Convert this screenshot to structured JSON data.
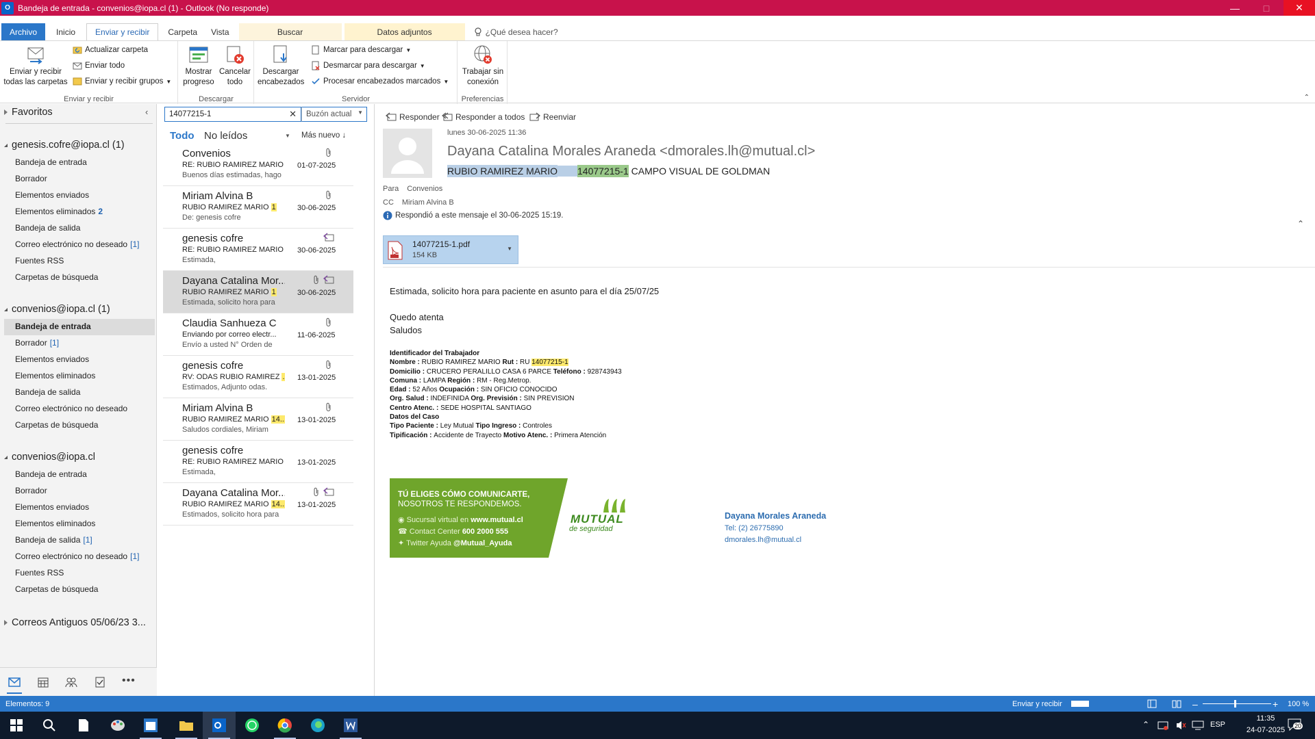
{
  "window": {
    "title": "Bandeja de entrada - convenios@iopa.cl (1) - Outlook (No responde)"
  },
  "ribbon": {
    "tabs": [
      "Archivo",
      "Inicio",
      "Enviar y recibir",
      "Carpeta",
      "Vista",
      "Buscar",
      "Datos adjuntos"
    ],
    "tell_me": "¿Qué desea hacer?",
    "send_receive_all": "Enviar y recibir todas las carpetas",
    "update_folder": "Actualizar carpeta",
    "send_all": "Enviar todo",
    "send_receive_groups": "Enviar y recibir grupos",
    "group_send_receive": "Enviar y recibir",
    "show_progress": "Mostrar progreso",
    "cancel_all": "Cancelar todo",
    "group_download": "Descargar",
    "download_headers": "Descargar encabezados",
    "mark_download": "Marcar para descargar",
    "unmark_download": "Desmarcar para descargar",
    "process_headers": "Procesar encabezados marcados",
    "group_server": "Servidor",
    "work_offline": "Trabajar sin conexión",
    "group_prefs": "Preferencias"
  },
  "nav": {
    "favorites": "Favoritos",
    "account1": {
      "name": "genesis.cofre@iopa.cl (1)",
      "items": [
        {
          "label": "Bandeja de entrada",
          "count": ""
        },
        {
          "label": "Borrador",
          "count": ""
        },
        {
          "label": "Elementos enviados",
          "count": ""
        },
        {
          "label": "Elementos eliminados",
          "count": "2"
        },
        {
          "label": "Bandeja de salida",
          "count": ""
        },
        {
          "label": "Correo electrónico no deseado",
          "count": "[1]"
        },
        {
          "label": "Fuentes RSS",
          "count": ""
        },
        {
          "label": "Carpetas de búsqueda",
          "count": ""
        }
      ]
    },
    "account2": {
      "name": "convenios@iopa.cl (1)",
      "items": [
        {
          "label": "Bandeja de entrada",
          "count": ""
        },
        {
          "label": "Borrador",
          "count": "[1]"
        },
        {
          "label": "Elementos enviados",
          "count": ""
        },
        {
          "label": "Elementos eliminados",
          "count": ""
        },
        {
          "label": "Bandeja de salida",
          "count": ""
        },
        {
          "label": "Correo electrónico no deseado",
          "count": ""
        },
        {
          "label": "Carpetas de búsqueda",
          "count": ""
        }
      ]
    },
    "account3": {
      "name": "convenios@iopa.cl",
      "items": [
        {
          "label": "Bandeja de entrada",
          "count": ""
        },
        {
          "label": "Borrador",
          "count": ""
        },
        {
          "label": "Elementos enviados",
          "count": ""
        },
        {
          "label": "Elementos eliminados",
          "count": ""
        },
        {
          "label": "Bandeja de salida",
          "count": "[1]"
        },
        {
          "label": "Correo electrónico no deseado",
          "count": "[1]"
        },
        {
          "label": "Fuentes RSS",
          "count": ""
        },
        {
          "label": "Carpetas de búsqueda",
          "count": ""
        }
      ]
    },
    "archive": "Correos Antiguos 05/06/23 3..."
  },
  "list": {
    "search_value": "14077215-1",
    "scope": "Buzón actual",
    "filter_all": "Todo",
    "filter_unread": "No leídos",
    "sort": "Más nuevo",
    "messages": [
      {
        "from": "Convenios",
        "subject": "RE: RUBIO RAMIREZ MARIO",
        "hl": "...",
        "preview": "Buenos días estimadas, hago",
        "date": "01-07-2025",
        "icon": "attach"
      },
      {
        "from": "Miriam Alvina B",
        "subject": "RUBIO RAMIREZ MARIO",
        "hl": "1",
        "preview": "De: genesis cofre",
        "date": "30-06-2025",
        "icon": "attach"
      },
      {
        "from": "genesis cofre",
        "subject": "RE: RUBIO RAMIREZ MARIO",
        "hl": "...",
        "preview": "Estimada,",
        "date": "30-06-2025",
        "icon": "reply"
      },
      {
        "from": "Dayana Catalina Mor...",
        "subject": "RUBIO RAMIREZ MARIO",
        "hl": "1",
        "preview": "Estimada, solicito hora para",
        "date": "30-06-2025",
        "icon": "both"
      },
      {
        "from": "Claudia Sanhueza C",
        "subject": "Enviando por correo electr...",
        "hl": "",
        "preview": "Envío a usted N° Orden de",
        "date": "11-06-2025",
        "icon": "attach"
      },
      {
        "from": "genesis cofre",
        "subject": "RV: ODAS RUBIO RAMIREZ",
        "hl": "...",
        "preview": "Estimados,  Adjunto odas.",
        "date": "13-01-2025",
        "icon": "attach"
      },
      {
        "from": "Miriam Alvina B",
        "subject": "RUBIO RAMIREZ MARIO",
        "hl": "14...",
        "preview": "Saludos cordiales,  Miriam",
        "date": "13-01-2025",
        "icon": "attach"
      },
      {
        "from": "genesis cofre",
        "subject": "RE: RUBIO RAMIREZ MARIO",
        "hl": "...",
        "preview": "Estimada,",
        "date": "13-01-2025",
        "icon": ""
      },
      {
        "from": "Dayana Catalina Mor...",
        "subject": "RUBIO RAMIREZ MARIO",
        "hl": "14...",
        "preview": "Estimados, solicito hora para",
        "date": "13-01-2025",
        "icon": "both"
      }
    ]
  },
  "reading": {
    "reply": "Responder",
    "reply_all": "Responder a todos",
    "forward": "Reenviar",
    "date": "lunes 30-06-2025 11:36",
    "sender": "Dayana Catalina Morales Araneda <dmorales.lh@mutual.cl>",
    "subject_a": "RUBIO RAMIREZ MARIO",
    "subject_b": "14077215-1",
    "subject_c": "CAMPO VISUAL DE GOLDMAN",
    "to_label": "Para",
    "to": "Convenios",
    "cc_label": "CC",
    "cc": "Miriam Alvina B",
    "info": "Respondió a este mensaje el 30-06-2025 15:19.",
    "attachment_name": "14077215-1.pdf",
    "attachment_size": "154 KB",
    "body1": "Estimada, solicito hora para paciente en asunto para el día 25/07/25",
    "body2": "Quedo atenta",
    "body3": "Saludos",
    "worker": {
      "title": "Identificador del Trabajador",
      "l1a": "Nombre : ",
      "l1b": "RUBIO RAMIREZ MARIO ",
      "l1c": "Rut : ",
      "l1d": "RU ",
      "l1e": "14077215-1",
      "l2a": "Domicilio : ",
      "l2b": "CRUCERO PERALILLO CASA 6 PARCE ",
      "l2c": "Teléfono : ",
      "l2d": "928743943",
      "l3a": "Comuna : ",
      "l3b": "LAMPA ",
      "l3c": "Región : ",
      "l3d": "RM - Reg.Metrop.",
      "l4a": "Edad : ",
      "l4b": "52 Años ",
      "l4c": "Ocupación : ",
      "l4d": "SIN OFICIO CONOCIDO",
      "l5a": "Org. Salud : ",
      "l5b": "INDEFINIDA ",
      "l5c": "Org. Previsión : ",
      "l5d": "SIN PREVISION",
      "l6a": "Centro Atenc. : ",
      "l6b": "SEDE HOSPITAL SANTIAGO",
      "l7": "Datos del Caso",
      "l8a": "Tipo Paciente : ",
      "l8b": "Ley Mutual ",
      "l8c": "Tipo Ingreso : ",
      "l8d": "Controles",
      "l9a": "Tipificación : ",
      "l9b": "Accidente de Trayecto ",
      "l9c": "Motivo Atenc. : ",
      "l9d": "Primera Atención"
    },
    "banner": {
      "line1": "TÚ ELIGES CÓMO COMUNICARTE,",
      "line2": "NOSOTROS TE RESPONDEMOS.",
      "l3a": "Sucursal virtual en ",
      "l3b": "www.mutual.cl",
      "l4a": "Contact Center ",
      "l4b": "600 2000 555",
      "l5a": "Twitter Ayuda ",
      "l5b": "@Mutual_Ayuda",
      "logo_main": "MUTUAL",
      "logo_sub": "de seguridad"
    },
    "sig": {
      "name": "Dayana Morales Araneda",
      "tel": "Tel: (2) 26775890",
      "email": "dmorales.lh@mutual.cl"
    }
  },
  "status": {
    "items": "Elementos: 9",
    "send_receive": "Enviar y recibir",
    "zoom": "100 %"
  },
  "taskbar": {
    "lang": "ESP",
    "time": "11:35",
    "date": "24-07-2025",
    "notif": "20"
  },
  "colors": {
    "title_bar": "#c8124b",
    "accent": "#2b77c9",
    "highlight": "#fde96c",
    "mutual_green": "#7ab32e"
  }
}
